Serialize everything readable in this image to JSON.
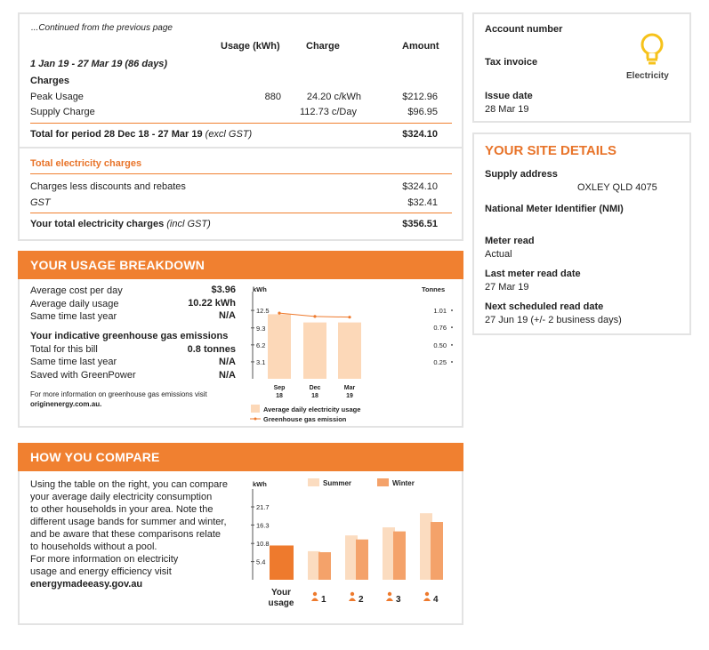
{
  "bill": {
    "continued": "...Continued from the previous page",
    "col_usage": "Usage (kWh)",
    "col_charge": "Charge",
    "col_amount": "Amount",
    "period_heading": "1 Jan 19 - 27 Mar 19 (86 days)",
    "charges_heading": "Charges",
    "rows": [
      {
        "label": "Peak Usage",
        "usage": "880",
        "charge": "24.20 c/kWh",
        "amount": "$212.96"
      },
      {
        "label": "Supply Charge",
        "usage": "",
        "charge": "112.73 c/Day",
        "amount": "$96.95"
      }
    ],
    "total_period_label": "Total for period 28 Dec 18 - 27 Mar 19",
    "total_period_note": "(excl GST)",
    "total_period_amount": "$324.10",
    "total_electricity_heading": "Total electricity charges",
    "less_discounts_label": "Charges less discounts and rebates",
    "less_discounts_amount": "$324.10",
    "gst_label": "GST",
    "gst_amount": "$32.41",
    "grand_total_label": "Your total electricity charges",
    "grand_total_note": "(incl GST)",
    "grand_total_amount": "$356.51"
  },
  "account": {
    "account_number_label": "Account number",
    "tax_invoice_label": "Tax invoice",
    "issue_date_label": "Issue date",
    "issue_date": "28 Mar 19",
    "fuel_label": "Electricity",
    "fuel_icon": "lightbulb-icon"
  },
  "site": {
    "heading": "YOUR SITE DETAILS",
    "supply_address_label": "Supply address",
    "supply_address": "OXLEY QLD 4075",
    "nmi_label": "National Meter Identifier (NMI)",
    "meter_read_label": "Meter read",
    "meter_read": "Actual",
    "last_read_label": "Last meter read date",
    "last_read": "27 Mar 19",
    "next_read_label": "Next scheduled read date",
    "next_read": "27 Jun 19 (+/- 2 business days)"
  },
  "usage": {
    "heading": "YOUR USAGE BREAKDOWN",
    "avg_cost_label": "Average cost per day",
    "avg_cost": "$3.96",
    "avg_usage_label": "Average daily usage",
    "avg_usage": "10.22 kWh",
    "same_time_label": "Same time last year",
    "same_time": "N/A",
    "ghg_heading": "Your indicative greenhouse gas emissions",
    "ghg_total_label": "Total for this bill",
    "ghg_total": "0.8 tonnes",
    "ghg_same_label": "Same time last year",
    "ghg_same": "N/A",
    "ghg_green_label": "Saved with GreenPower",
    "ghg_green": "N/A",
    "more_info": "For more information on greenhouse gas emissions visit",
    "more_info_link": "originenergy.com.au."
  },
  "compare": {
    "heading": "HOW YOU COMPARE",
    "lines": [
      "Using the table on the right, you can compare",
      "your average daily electricity consumption",
      "to other households in your area. Note the",
      "different usage bands for summer and winter,",
      "and be aware that these comparisons relate",
      "to households without a pool.",
      "For more information on electricity",
      "usage and energy efficiency visit"
    ],
    "link": "energymadeeasy.gov.au"
  },
  "colors": {
    "accent": "#f08030",
    "light_bar": "#fcd8b8",
    "summer": "#fbdcc0",
    "winter": "#f4a26a",
    "your_usage": "#ee7a2d"
  },
  "chart_data": [
    {
      "type": "bar",
      "y_label_left": "kWh",
      "y_label_right": "Tonnes",
      "categories": [
        "Sep 18",
        "Dec 18",
        "Mar 19"
      ],
      "y_ticks": [
        "3.1",
        "6.2",
        "9.3",
        "12.5"
      ],
      "y2_ticks": [
        "0.25",
        "0.50",
        "0.76",
        "1.01"
      ],
      "ylim": [
        0,
        15.6
      ],
      "y2lim": [
        0,
        1.26
      ],
      "series": [
        {
          "name": "Average daily electricity usage",
          "type": "bar",
          "values": [
            11.8,
            10.3,
            10.3
          ]
        },
        {
          "name": "Greenhouse gas emission",
          "type": "line",
          "values": [
            0.97,
            0.92,
            0.91
          ]
        }
      ],
      "legend": "bottom"
    },
    {
      "type": "bar",
      "y_label": "kWh",
      "y_ticks": [
        "5.4",
        "10.8",
        "16.3",
        "21.7"
      ],
      "ylim": [
        0,
        27
      ],
      "your_usage": {
        "label": "Your usage",
        "value": 10.2
      },
      "categories": [
        "1",
        "2",
        "3",
        "4"
      ],
      "series": [
        {
          "name": "Summer",
          "values": [
            8.5,
            13.2,
            15.6,
            19.8
          ]
        },
        {
          "name": "Winter",
          "values": [
            8.2,
            12.0,
            14.4,
            17.2
          ]
        }
      ],
      "legend": "top"
    }
  ]
}
